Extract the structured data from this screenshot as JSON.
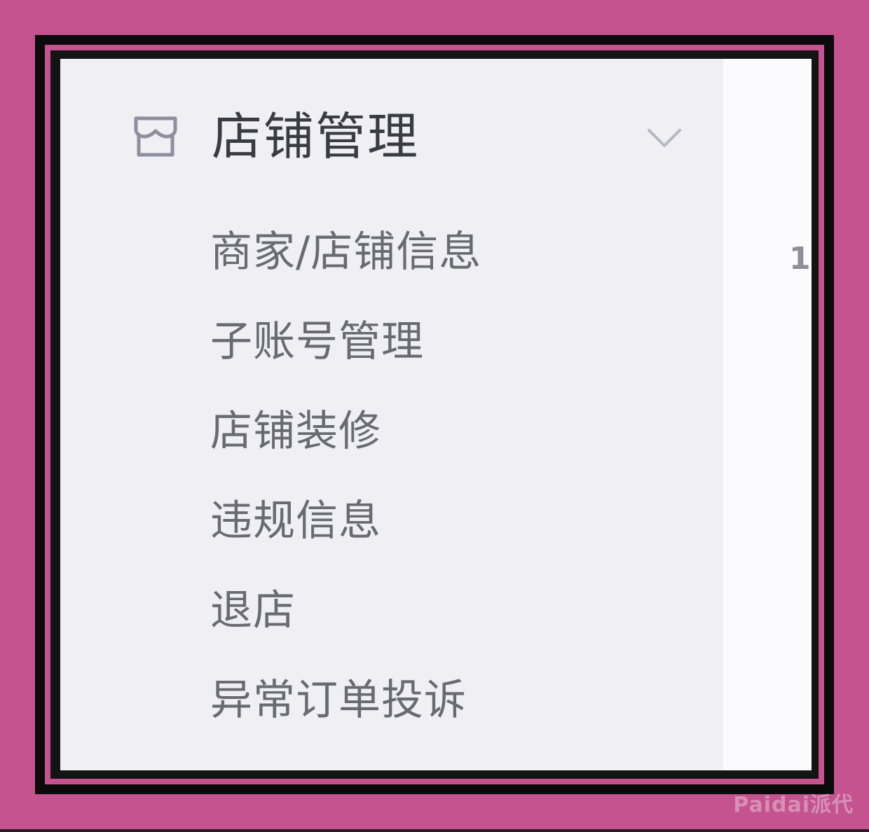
{
  "sidebar": {
    "group": {
      "title": "店铺管理",
      "icon": "store-icon",
      "expanded": true,
      "toggle_icon": "chevron-down-icon"
    },
    "items": [
      {
        "label": "商家/店铺信息"
      },
      {
        "label": "子账号管理"
      },
      {
        "label": "店铺装修"
      },
      {
        "label": "违规信息"
      },
      {
        "label": "退店"
      },
      {
        "label": "异常订单投诉"
      }
    ]
  },
  "content": {
    "peek_text": "1"
  },
  "watermark": {
    "text": "Paidai派代"
  },
  "colors": {
    "border_pink": "#c4538f",
    "border_black": "#0b0b0b",
    "sidebar_bg": "#efeff4",
    "content_bg": "#fbfbfd",
    "title_text": "#3b3b42",
    "item_text": "#6a6a72"
  }
}
